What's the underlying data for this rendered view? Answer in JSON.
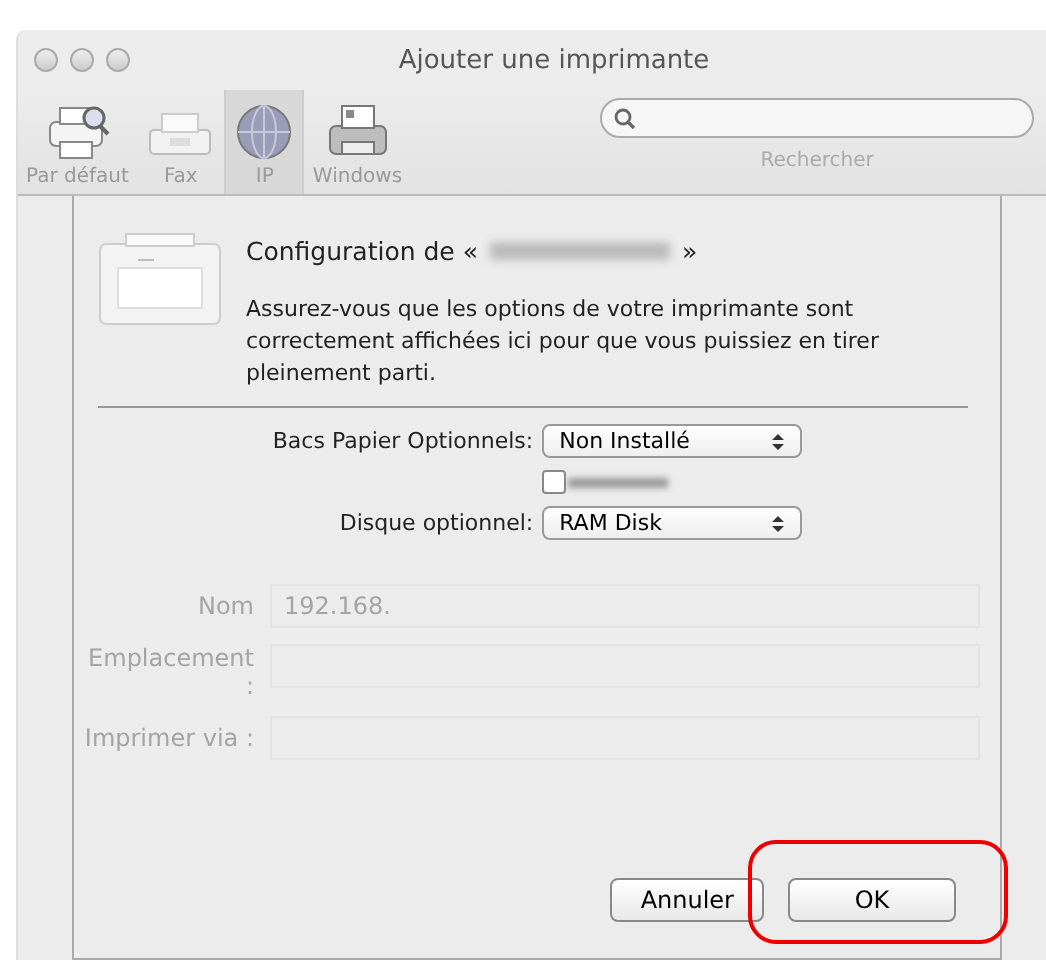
{
  "window": {
    "title": "Ajouter une imprimante"
  },
  "toolbar": [
    {
      "label": "Par défaut",
      "kind": "default",
      "selected": false
    },
    {
      "label": "Fax",
      "kind": "fax",
      "selected": false
    },
    {
      "label": "IP",
      "kind": "ip",
      "selected": true
    },
    {
      "label": "Windows",
      "kind": "windows",
      "selected": false
    }
  ],
  "search": {
    "label": "Rechercher"
  },
  "sheet": {
    "title_prefix": "Configuration de «",
    "title_suffix": "»",
    "description": "Assurez-vous que les options de votre imprimante sont correctement affichées ici pour que vous puissiez en tirer pleinement parti.",
    "options": [
      {
        "kind": "popup",
        "label": "Bacs Papier Optionnels:",
        "value": "Non Installé"
      },
      {
        "kind": "checkbox",
        "checked": false
      },
      {
        "kind": "popup",
        "label": "Disque optionnel:",
        "value": "RAM Disk"
      }
    ],
    "background_fields": [
      {
        "label": "Nom",
        "value": "192.168."
      },
      {
        "label": "Emplacement :"
      },
      {
        "label": "Imprimer via :"
      }
    ],
    "buttons": [
      {
        "label": "Annuler",
        "highlighted": false
      },
      {
        "label": "OK",
        "highlighted": true
      }
    ]
  }
}
